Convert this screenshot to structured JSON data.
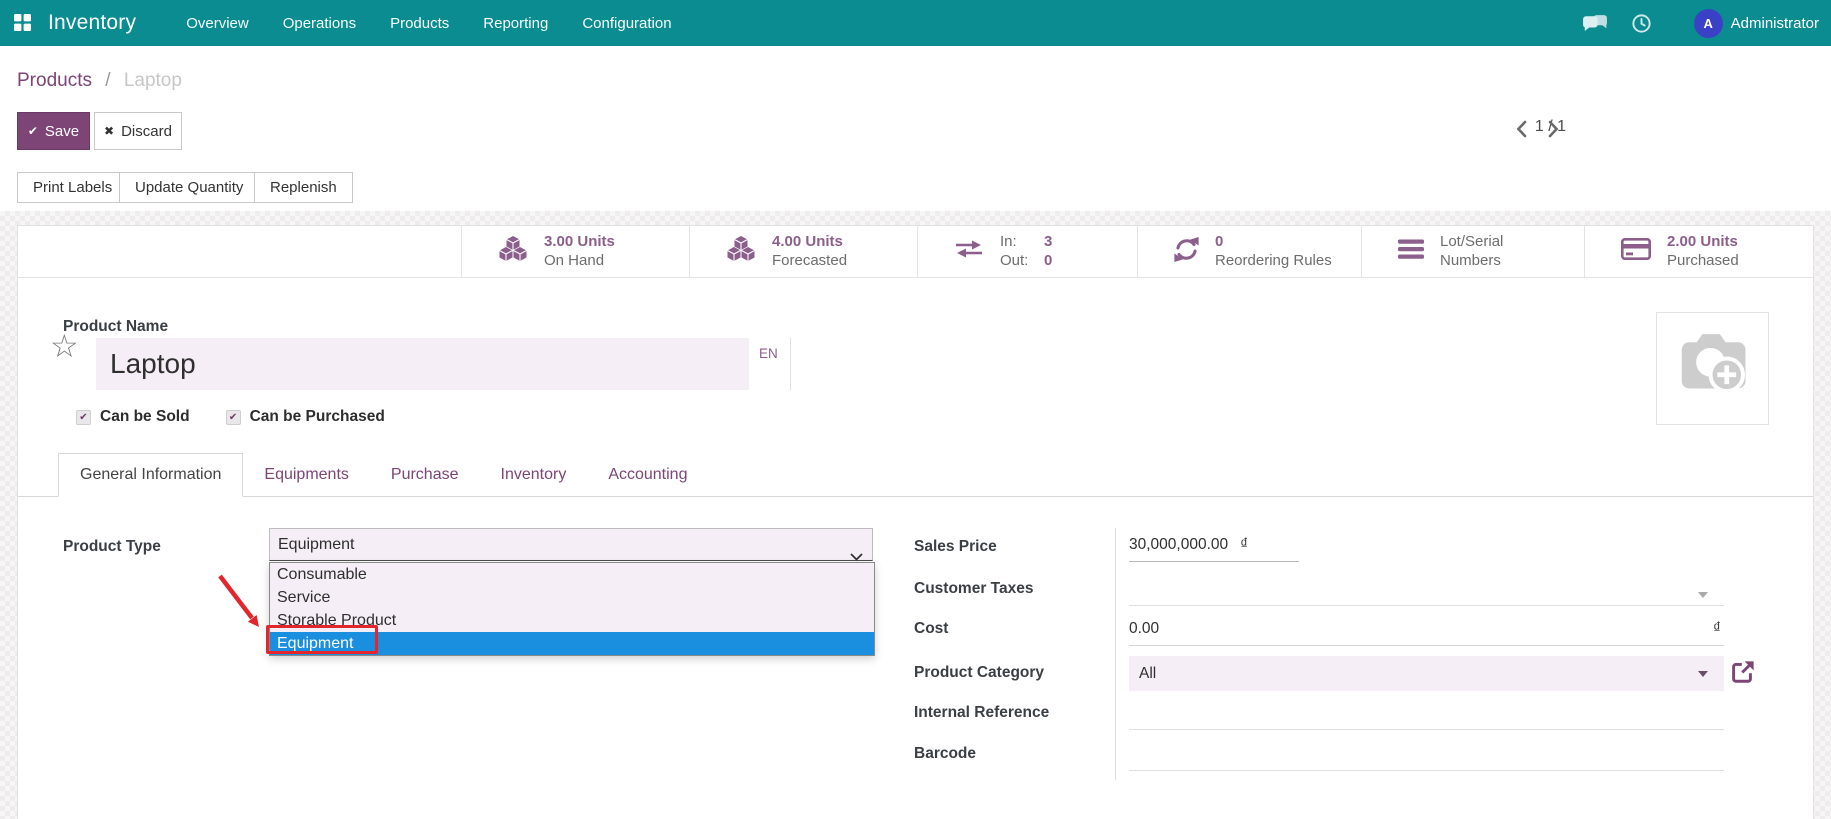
{
  "navbar": {
    "brand": "Inventory",
    "menu": [
      "Overview",
      "Operations",
      "Products",
      "Reporting",
      "Configuration"
    ],
    "user_name": "Administrator",
    "avatar_initial": "A"
  },
  "breadcrumb": {
    "parent": "Products",
    "separator": "/",
    "current": "Laptop"
  },
  "actions": {
    "save": "Save",
    "discard": "Discard",
    "save_icon": "✔",
    "discard_icon": "✖"
  },
  "pager": {
    "counter": "1 / 1"
  },
  "smart_buttons": [
    "Print Labels",
    "Update Quantity",
    "Replenish"
  ],
  "stats": [
    {
      "value": "3.00 Units",
      "label": "On Hand"
    },
    {
      "value": "4.00 Units",
      "label": "Forecasted"
    },
    {
      "rows": [
        {
          "label": "In:",
          "value": "3"
        },
        {
          "label": "Out:",
          "value": "0"
        }
      ]
    },
    {
      "value": "0",
      "label": "Reordering Rules"
    },
    {
      "label": "Lot/Serial Numbers"
    },
    {
      "value": "2.00 Units",
      "label": "Purchased"
    }
  ],
  "product": {
    "name_label": "Product Name",
    "name": "Laptop",
    "language_badge": "EN",
    "favorite_icon": "☆",
    "check_glyph": "✔",
    "can_be_sold": "Can be Sold",
    "can_be_purchased": "Can be Purchased"
  },
  "tabs": [
    "General Information",
    "Equipments",
    "Purchase",
    "Inventory",
    "Accounting"
  ],
  "form": {
    "product_type": {
      "label": "Product Type",
      "value": "Equipment",
      "options": [
        "Consumable",
        "Service",
        "Storable Product",
        "Equipment"
      ],
      "highlighted_option": "Equipment"
    },
    "sales_price": {
      "label": "Sales Price",
      "value": "30,000,000.00",
      "currency": "₫"
    },
    "customer_taxes": {
      "label": "Customer Taxes",
      "value": ""
    },
    "cost": {
      "label": "Cost",
      "value": "0.00",
      "currency": "₫"
    },
    "product_category": {
      "label": "Product Category",
      "value": "All"
    },
    "internal_reference": {
      "label": "Internal Reference",
      "value": ""
    },
    "barcode": {
      "label": "Barcode",
      "value": ""
    }
  },
  "colors": {
    "navbar_teal": "#0b8c90",
    "accent_purple": "#7c4576",
    "stat_purple": "#8b5e8b",
    "highlight_blue": "#1a8fe0",
    "annotation_red": "#e2262b",
    "field_lavender": "#f6eef6"
  }
}
